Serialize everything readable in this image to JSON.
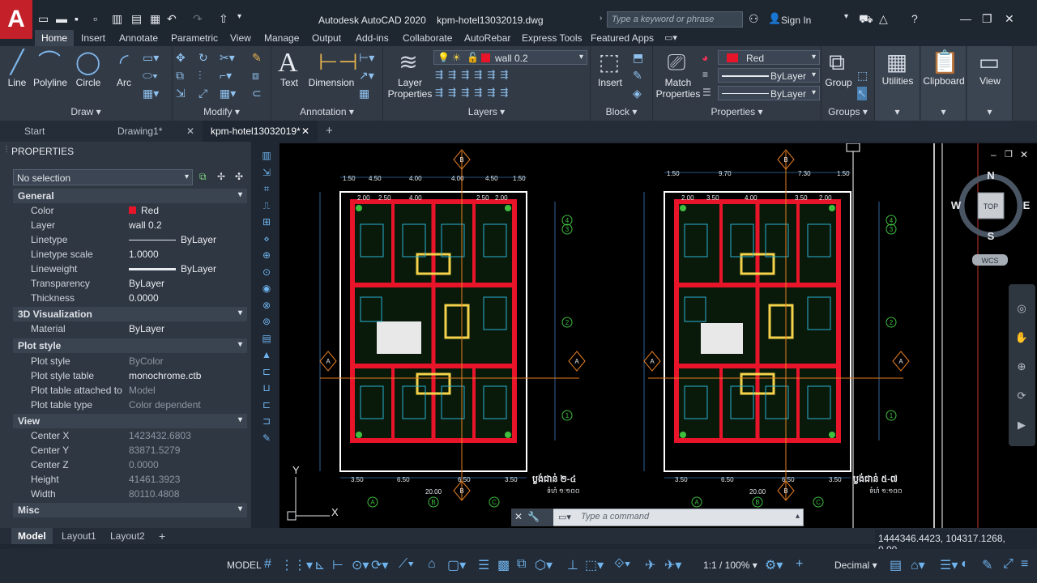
{
  "app": {
    "logo": "A",
    "title": "Autodesk AutoCAD 2020",
    "filename": "kpm-hotel13032019.dwg",
    "search_placeholder": "Type a keyword or phrase",
    "signin": "Sign In"
  },
  "ribbon_tabs": [
    "Home",
    "Insert",
    "Annotate",
    "Parametric",
    "View",
    "Manage",
    "Output",
    "Add-ins",
    "Collaborate",
    "AutoRebar",
    "Express Tools",
    "Featured Apps"
  ],
  "ribbon": {
    "draw": {
      "label": "Draw",
      "line": "Line",
      "polyline": "Polyline",
      "circle": "Circle",
      "arc": "Arc"
    },
    "modify": {
      "label": "Modify"
    },
    "annotation": {
      "label": "Annotation",
      "text": "Text",
      "dimension": "Dimension"
    },
    "layers": {
      "label": "Layers",
      "layer_properties_1": "Layer",
      "layer_properties_2": "Properties",
      "current_layer": "wall 0.2"
    },
    "block": {
      "label": "Block",
      "insert": "Insert"
    },
    "properties": {
      "label": "Properties",
      "match_1": "Match",
      "match_2": "Properties",
      "color": "Red",
      "linetype": "ByLayer",
      "lineweight": "ByLayer"
    },
    "groups": {
      "label": "Groups",
      "group": "Group"
    },
    "utilities": "Utilities",
    "clipboard": "Clipboard",
    "view": "View"
  },
  "doc_tabs": [
    "Start",
    "Drawing1*",
    "kpm-hotel13032019*"
  ],
  "properties_panel": {
    "title": "PROPERTIES",
    "selection": "No selection",
    "general": {
      "title": "General",
      "color_k": "Color",
      "color_v": "Red",
      "layer_k": "Layer",
      "layer_v": "wall 0.2",
      "linetype_k": "Linetype",
      "linetype_v": "ByLayer",
      "ltscale_k": "Linetype scale",
      "ltscale_v": "1.0000",
      "lineweight_k": "Lineweight",
      "lineweight_v": "ByLayer",
      "transparency_k": "Transparency",
      "transparency_v": "ByLayer",
      "thickness_k": "Thickness",
      "thickness_v": "0.0000"
    },
    "viz": {
      "title": "3D Visualization",
      "material_k": "Material",
      "material_v": "ByLayer"
    },
    "plot": {
      "title": "Plot style",
      "ps_k": "Plot style",
      "ps_v": "ByColor",
      "pst_k": "Plot style table",
      "pst_v": "monochrome.ctb",
      "pta_k": "Plot table attached to",
      "pta_v": "Model",
      "ptt_k": "Plot table type",
      "ptt_v": "Color dependent"
    },
    "view": {
      "title": "View",
      "cx_k": "Center X",
      "cx_v": "1423432.6803",
      "cy_k": "Center Y",
      "cy_v": "83871.5279",
      "cz_k": "Center Z",
      "cz_v": "0.0000",
      "h_k": "Height",
      "h_v": "41461.3923",
      "w_k": "Width",
      "w_v": "80110.4808"
    },
    "misc": {
      "title": "Misc"
    }
  },
  "viewcube": {
    "n": "N",
    "s": "S",
    "e": "E",
    "w": "W",
    "top": "TOP",
    "wcs": "WCS"
  },
  "drawing": {
    "plan1": {
      "top_dims": [
        "1.50",
        "4.50",
        "4.00",
        "4.00",
        "4.50",
        "1.50"
      ],
      "room_dims": [
        "2.00",
        "2.50",
        "4.00",
        "2.50",
        "2.00"
      ],
      "bottom_dims": [
        "3.50",
        "6.50",
        "6.50",
        "3.50"
      ],
      "total": "20.00",
      "caption": "ប្លង់ជាន់ ២-៤",
      "sub": "ទំហំ ១:១០០"
    },
    "plan2": {
      "top_dims": [
        "1.50",
        "9.70",
        "7.30",
        "1.50"
      ],
      "room_dims": [
        "2.00",
        "3.50",
        "4.00",
        "3.50",
        "2.00"
      ],
      "bottom_dims": [
        "3.50",
        "6.50",
        "6.50",
        "3.50"
      ],
      "total": "20.00",
      "caption": "ប្លង់ជាន់ ៥-៧",
      "sub": "ទំហំ ១:១០០"
    },
    "grid_letters": [
      "A",
      "B",
      "C"
    ],
    "grid_numbers": [
      "1",
      "2",
      "3",
      "4"
    ]
  },
  "command": {
    "placeholder": "Type a command"
  },
  "layout_tabs": [
    "Model",
    "Layout1",
    "Layout2"
  ],
  "status": {
    "coords": "1444346.4423, 104317.1268, 0.00...",
    "model": "MODEL",
    "scale": "1:1 / 100%",
    "units": "Decimal"
  },
  "colors": {
    "accent": "#c3202a",
    "wall": "#e8142a",
    "dim": "#53a9ff",
    "furniture": "#2bb3d6"
  }
}
